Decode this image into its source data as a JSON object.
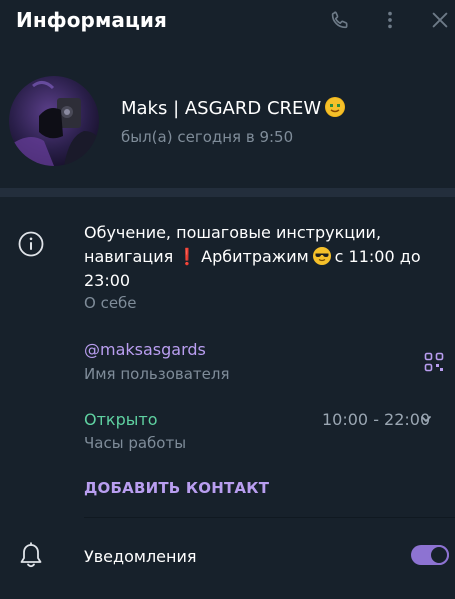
{
  "header": {
    "title": "Информация",
    "icons": [
      "phone-icon",
      "more-vertical-icon",
      "close-icon"
    ]
  },
  "profile": {
    "name": "Maks | ASGARD CREW",
    "name_emoji": "money-face-emoji",
    "status": "был(а) сегодня в 9:50"
  },
  "about": {
    "bio_part1": "Обучение, пошаговые инструкции, навигация",
    "bio_excl": "❗",
    "bio_part2": "Арбитражим",
    "bio_part3": "с 11:00 до 23:00",
    "label": "О себе"
  },
  "username": {
    "value": "@maksasgards",
    "label": "Имя пользователя"
  },
  "hours": {
    "status": "Открыто",
    "value": "10:00 - 22:00",
    "label": "Часы работы"
  },
  "actions": {
    "add_contact": "ДОБАВИТЬ КОНТАКТ"
  },
  "notifications": {
    "label": "Уведомления",
    "enabled": true
  },
  "colors": {
    "background": "#17212b",
    "accent": "#b99ef0",
    "open": "#5fd1a1",
    "muted": "#7f8c99",
    "toggle": "#8d73d2"
  }
}
